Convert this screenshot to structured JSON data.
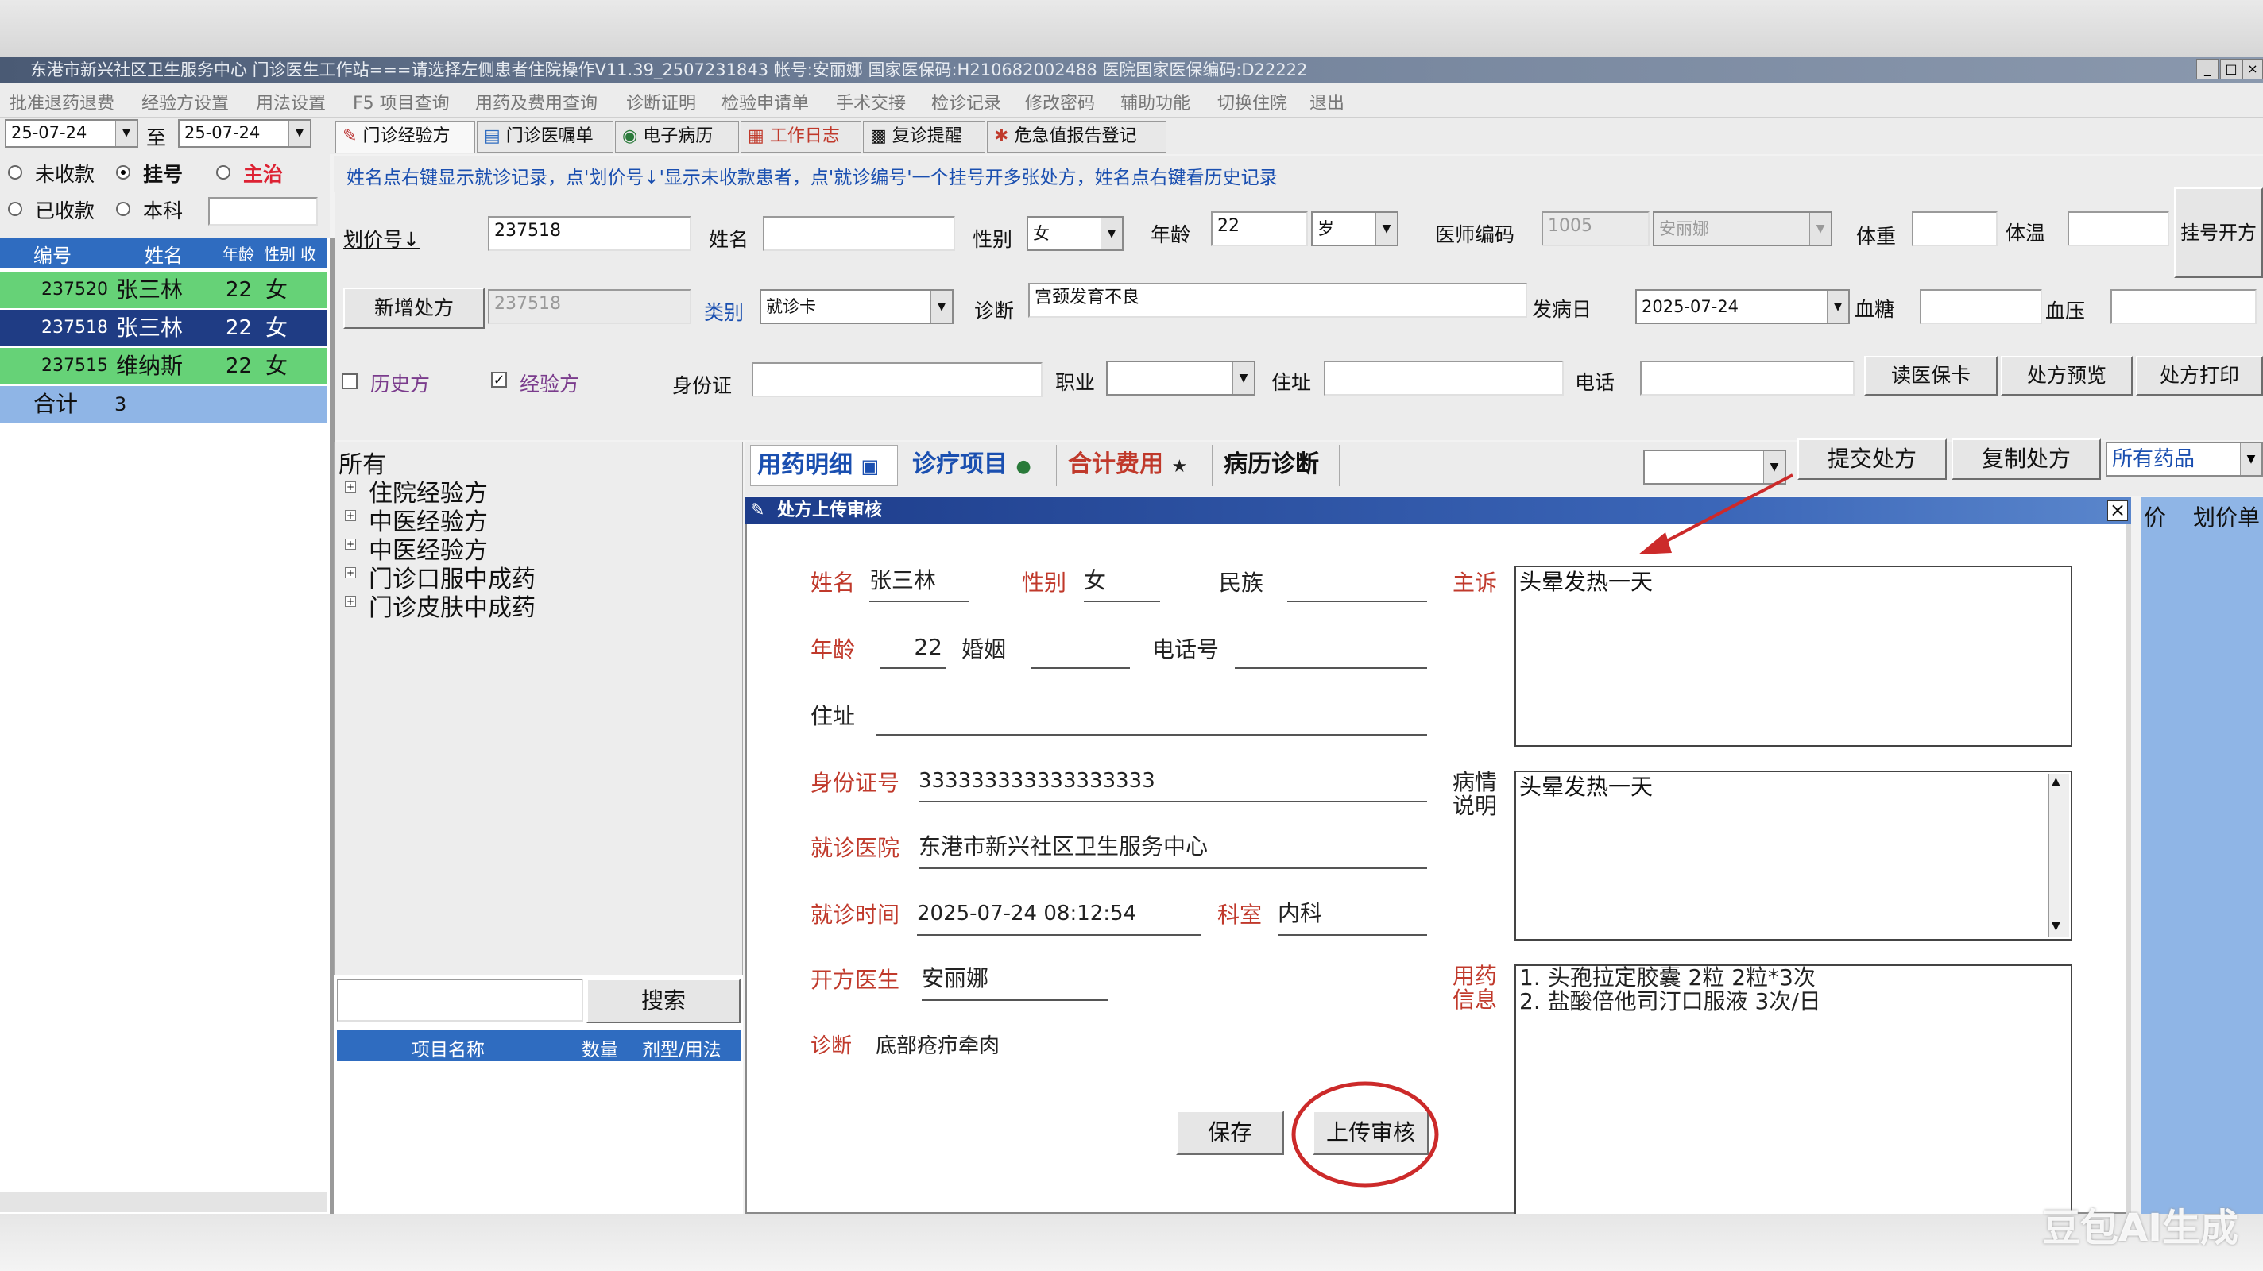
{
  "window": {
    "title": "东港市新兴社区卫生服务中心  门诊医生工作站===请选择左侧患者住院操作V11.39_2507231843     帐号:安丽娜  国家医保码:H210682002488  医院国家医保编码:D22222",
    "min_btn": "_",
    "max_btn": "□",
    "close_btn": "×"
  },
  "menu": [
    "批准退药退费",
    "经验方设置",
    "用法设置",
    "F5 项目查询",
    "用药及费用查询",
    "诊断证明",
    "检验申请单",
    "手术交接",
    "检诊记录",
    "修改密码",
    "辅助功能",
    "切换住院",
    "退出"
  ],
  "toolbar": {
    "date_from": "25-07-24",
    "to_label": "至",
    "date_to": "25-07-24",
    "tabs": [
      {
        "label": "门诊经验方",
        "icon": "pencil-icon"
      },
      {
        "label": "门诊医嘱单",
        "icon": "document-icon"
      },
      {
        "label": "电子病历",
        "icon": "record-icon"
      },
      {
        "label": "工作日志",
        "icon": "calendar-icon"
      },
      {
        "label": "复诊提醒",
        "icon": "reminder-icon"
      },
      {
        "label": "危急值报告登记",
        "icon": "alert-icon"
      }
    ]
  },
  "filters": {
    "unpaid": "未收款",
    "registered": "挂号",
    "attending": "主治",
    "paid": "已收款",
    "department": "本科"
  },
  "hint_text": "姓名点右键显示就诊记录，点'划价号↓'显示未收款患者，点'就诊编号'一个挂号开多张处方，姓名点右键看历史记录",
  "patient_table": {
    "headers": [
      "编号",
      "姓名",
      "年龄",
      "性别",
      "收"
    ],
    "rows": [
      {
        "id": "237520",
        "name": "张三林",
        "age": "22",
        "sex": "女",
        "state": "green"
      },
      {
        "id": "237518",
        "name": "张三林",
        "age": "22",
        "sex": "女",
        "state": "selected"
      },
      {
        "id": "237515",
        "name": "维纳斯",
        "age": "22",
        "sex": "女",
        "state": "green"
      }
    ],
    "total_label": "合计",
    "total_value": "3"
  },
  "form": {
    "price_no_label": "划价号↓",
    "price_no": "237518",
    "name_label": "姓名",
    "name": "",
    "sex_label": "性别",
    "sex": "女",
    "age_label": "年龄",
    "age": "22",
    "age_unit": "岁",
    "doctor_code_label": "医师编码",
    "doctor_code": "1005",
    "doctor_name": "安丽娜",
    "weight_label": "体重",
    "temp_label": "体温",
    "register_btn": "挂号开方",
    "new_rx_btn": "新增处方",
    "rx_no": "237518",
    "category_label": "类别",
    "category": "就诊卡",
    "diagnosis_label": "诊断",
    "diagnosis": "宫颈发育不良",
    "onset_label": "发病日",
    "onset_date": "2025-07-24",
    "blood_sugar_label": "血糖",
    "bp_label": "血压",
    "history_label": "历史方",
    "experience_label": "经验方",
    "id_label": "身份证",
    "job_label": "职业",
    "address_label": "住址",
    "phone_label": "电话",
    "read_card_btn": "读医保卡",
    "preview_btn": "处方预览",
    "print_btn": "处方打印"
  },
  "tree": {
    "root": "所有",
    "items": [
      "住院经验方",
      "中医经验方",
      "中医经验方",
      "门诊口服中成药",
      "门诊皮肤中成药"
    ],
    "search_btn": "搜索",
    "cols": [
      "项目名称",
      "数量",
      "剂型/用法"
    ]
  },
  "rx_tabs": [
    {
      "label": "用药明细",
      "color": "#1a4fb0"
    },
    {
      "label": "诊疗项目",
      "color": "#1a4fb0"
    },
    {
      "label": "合计费用",
      "color": "#c0392b"
    },
    {
      "label": "病历诊断",
      "color": "#111111"
    }
  ],
  "rx_actions": {
    "submit": "提交处方",
    "copy": "复制处方",
    "drug_filter": "所有药品",
    "price_col": "价",
    "price_list": "划价单"
  },
  "dialog": {
    "title": "处方上传审核",
    "close": "×",
    "name_label": "姓名",
    "name": "张三林",
    "sex_label": "性别",
    "sex": "女",
    "ethnic_label": "民族",
    "ethnic": "",
    "age_label": "年龄",
    "age": "22",
    "marriage_label": "婚姻",
    "phone_label": "电话号",
    "address_label": "住址",
    "id_label": "身份证号",
    "id_no": "333333333333333333",
    "hospital_label": "就诊医院",
    "hospital": "东港市新兴社区卫生服务中心",
    "visit_time_label": "就诊时间",
    "visit_time": "2025-07-24 08:12:54",
    "dept_label": "科室",
    "dept": "内科",
    "doctor_label": "开方医生",
    "doctor": "安丽娜",
    "diag_label": "诊断",
    "diag": "底部疮疖牵肉",
    "complaint_label": "主诉",
    "complaint": "头晕发热一天",
    "condition_label": "病情说明",
    "condition": "头晕发热一天",
    "drug_label": "用药信息",
    "drug_lines": [
      "1. 头孢拉定胶囊 2粒  2粒*3次",
      "2. 盐酸倍他司汀口服液 3次/日"
    ],
    "save_btn": "保存",
    "upload_btn": "上传审核"
  },
  "colors": {
    "title_blue": "#2f6cc0",
    "row_green": "#66d277",
    "row_selected": "#1f3c84",
    "total_blue": "#8fb5e6",
    "label_red": "#c0392b",
    "annotation_red": "#cc2a2a"
  },
  "watermark": "豆包AI生成"
}
